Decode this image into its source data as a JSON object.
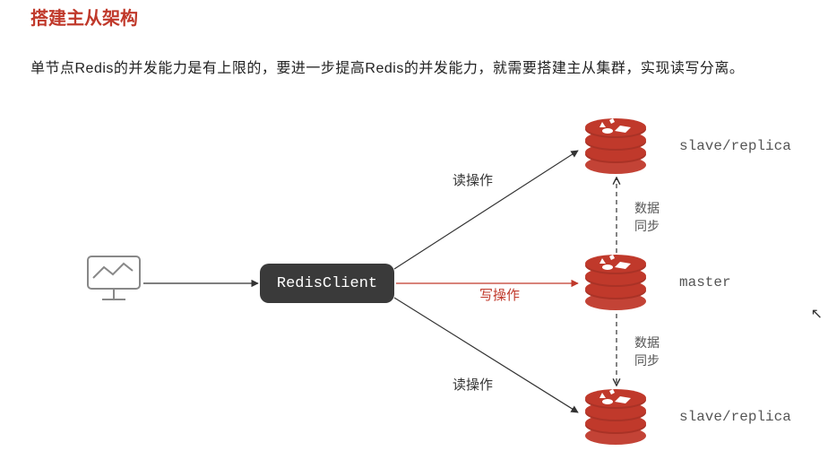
{
  "title": "搭建主从架构",
  "description": "单节点Redis的并发能力是有上限的，要进一步提高Redis的并发能力，就需要搭建主从集群，实现读写分离。",
  "client_box_label": "RedisClient",
  "edges": {
    "read_top": "读操作",
    "write": "写操作",
    "read_bottom": "读操作",
    "sync_top_l1": "数据",
    "sync_top_l2": "同步",
    "sync_bottom_l1": "数据",
    "sync_bottom_l2": "同步"
  },
  "nodes": {
    "slave_top": "slave/replica",
    "master": "master",
    "slave_bottom": "slave/replica"
  },
  "colors": {
    "title": "#c0392b",
    "redis_box": "#3a3a3a",
    "redis_cube": "#c0392b",
    "write_line": "#c0392b"
  }
}
